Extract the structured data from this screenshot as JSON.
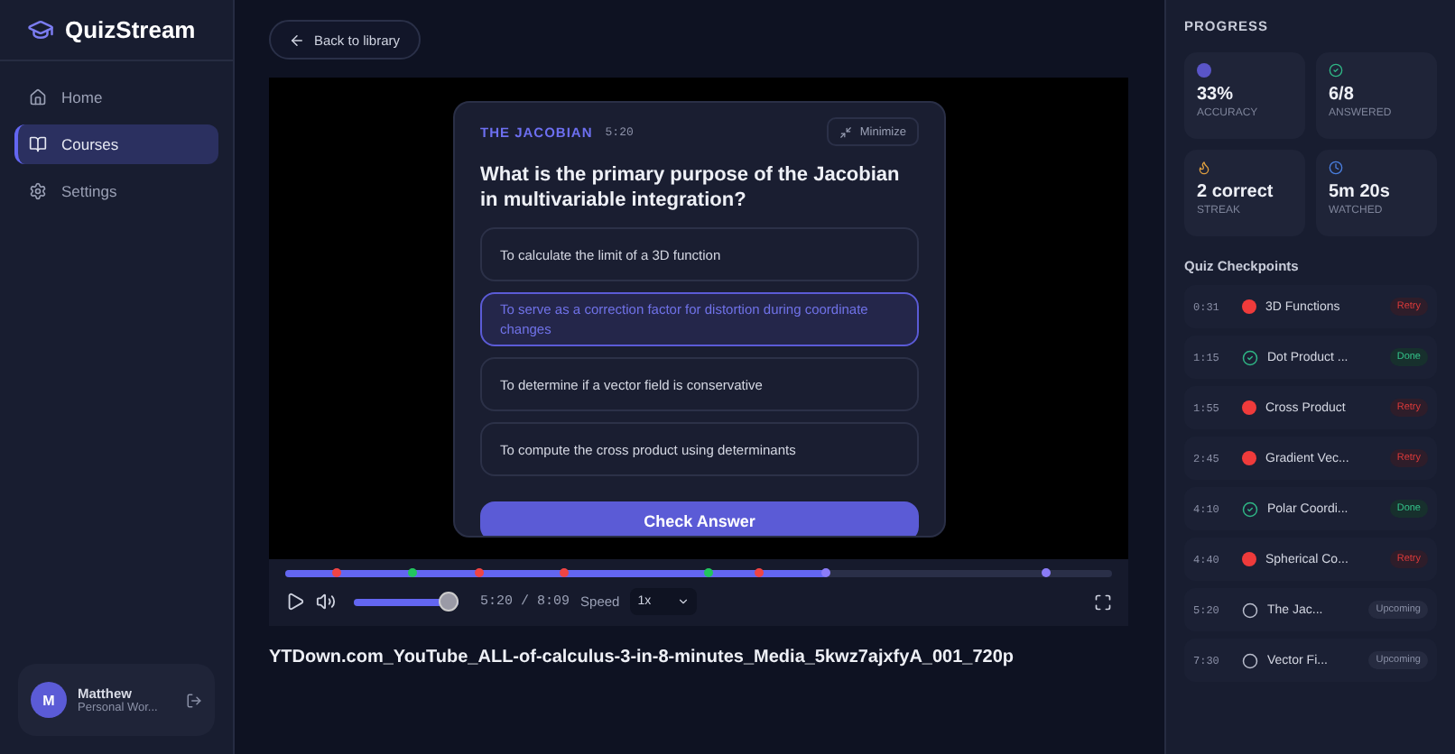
{
  "app": {
    "name": "QuizStream"
  },
  "nav": [
    {
      "label": "Home",
      "kind": "home",
      "selected": false
    },
    {
      "label": "Courses",
      "kind": "courses",
      "selected": true
    },
    {
      "label": "Settings",
      "kind": "settings",
      "selected": false
    }
  ],
  "user": {
    "initial": "M",
    "name": "Matthew",
    "workspace": "Personal Wor..."
  },
  "back_button": "Back to library",
  "quiz": {
    "topic": "THE JACOBIAN",
    "time": "5:20",
    "minimize": "Minimize",
    "question": "What is the primary purpose of the Jacobian in multivariable integration?",
    "options": [
      {
        "text": "To calculate the limit of a 3D function",
        "selected": false
      },
      {
        "text": "To serve as a correction factor for distortion during coordinate changes",
        "selected": true
      },
      {
        "text": "To determine if a vector field is conservative",
        "selected": false
      },
      {
        "text": "To compute the cross product using determinants",
        "selected": false
      }
    ],
    "submit": "Check Answer"
  },
  "player": {
    "progress": {
      "level": 0.654
    },
    "volume": {
      "level": 1.0
    },
    "time": "5:20 / 8:09",
    "speed_label": "Speed",
    "speed": "1x"
  },
  "video_title": "YTDown.com_YouTube_ALL-of-calculus-3-in-8-minutes_Media_5kwz7ajxfyA_001_720p",
  "progress": {
    "heading": "PROGRESS",
    "stats": [
      {
        "kind": "accuracy",
        "value": "33%",
        "label": "ACCURACY"
      },
      {
        "kind": "answered",
        "value": "6/8",
        "label": "ANSWERED"
      },
      {
        "kind": "streak",
        "value": "2 correct",
        "label": "STREAK"
      },
      {
        "kind": "watched",
        "value": "5m 20s",
        "label": "WATCHED"
      }
    ]
  },
  "checkpoints": {
    "heading": "Quiz Checkpoints",
    "items": [
      {
        "time": "0:31",
        "title": "3D Functions",
        "kind": "retry",
        "badge": "Retry",
        "level": 0.063
      },
      {
        "time": "1:15",
        "title": "Dot Product ...",
        "kind": "done",
        "badge": "Done",
        "level": 0.153
      },
      {
        "time": "1:55",
        "title": "Cross Product",
        "kind": "retry",
        "badge": "Retry",
        "level": 0.235
      },
      {
        "time": "2:45",
        "title": "Gradient Vec...",
        "kind": "retry",
        "badge": "Retry",
        "level": 0.337
      },
      {
        "time": "4:10",
        "title": "Polar Coordi...",
        "kind": "done",
        "badge": "Done",
        "level": 0.511
      },
      {
        "time": "4:40",
        "title": "Spherical Co...",
        "kind": "retry",
        "badge": "Retry",
        "level": 0.573
      },
      {
        "time": "5:20",
        "title": "The Jac...",
        "kind": "upcoming",
        "badge": "Upcoming",
        "level": 0.654
      },
      {
        "time": "7:30",
        "title": "Vector Fi...",
        "kind": "upcoming",
        "badge": "Upcoming",
        "level": 0.92
      }
    ]
  }
}
